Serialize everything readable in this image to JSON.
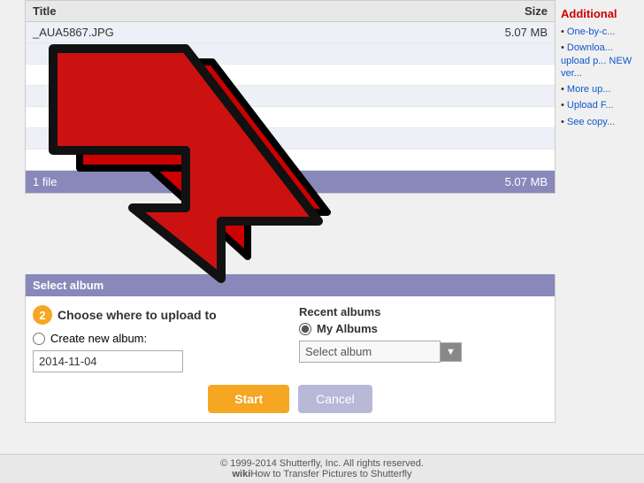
{
  "table": {
    "header": {
      "title_col": "Title",
      "size_col": "Size"
    },
    "rows": [
      {
        "title": "_AUA5867.JPG",
        "size": "5.07 MB"
      },
      {
        "title": "",
        "size": ""
      },
      {
        "title": "",
        "size": ""
      },
      {
        "title": "",
        "size": ""
      },
      {
        "title": "",
        "size": ""
      },
      {
        "title": "",
        "size": ""
      },
      {
        "title": "",
        "size": ""
      }
    ],
    "footer": {
      "count": "1 file",
      "total_size": "5.07 MB"
    }
  },
  "select_album_bar": "Select album",
  "choose": {
    "step": "2",
    "title": "Choose where to upload to",
    "radio_create": "Create new album:",
    "date_value": "2014-11-04",
    "recent_albums_label": "Recent albums",
    "my_albums_label": "My Albums",
    "select_placeholder": "Select album",
    "btn_start": "Start",
    "btn_cancel": "Cancel"
  },
  "sidebar": {
    "additional_title": "Additional",
    "items": [
      "One-by-c...",
      "Downloa... upload p... NEW ver...",
      "",
      "More up...",
      "Upload F...",
      "See copy..."
    ]
  },
  "footer": {
    "copyright": "© 1999-2014 Shutterfly, Inc. All rights reserved.",
    "wiki": "wiki",
    "how_text": "How to Transfer Pictures to Shutterfly"
  }
}
